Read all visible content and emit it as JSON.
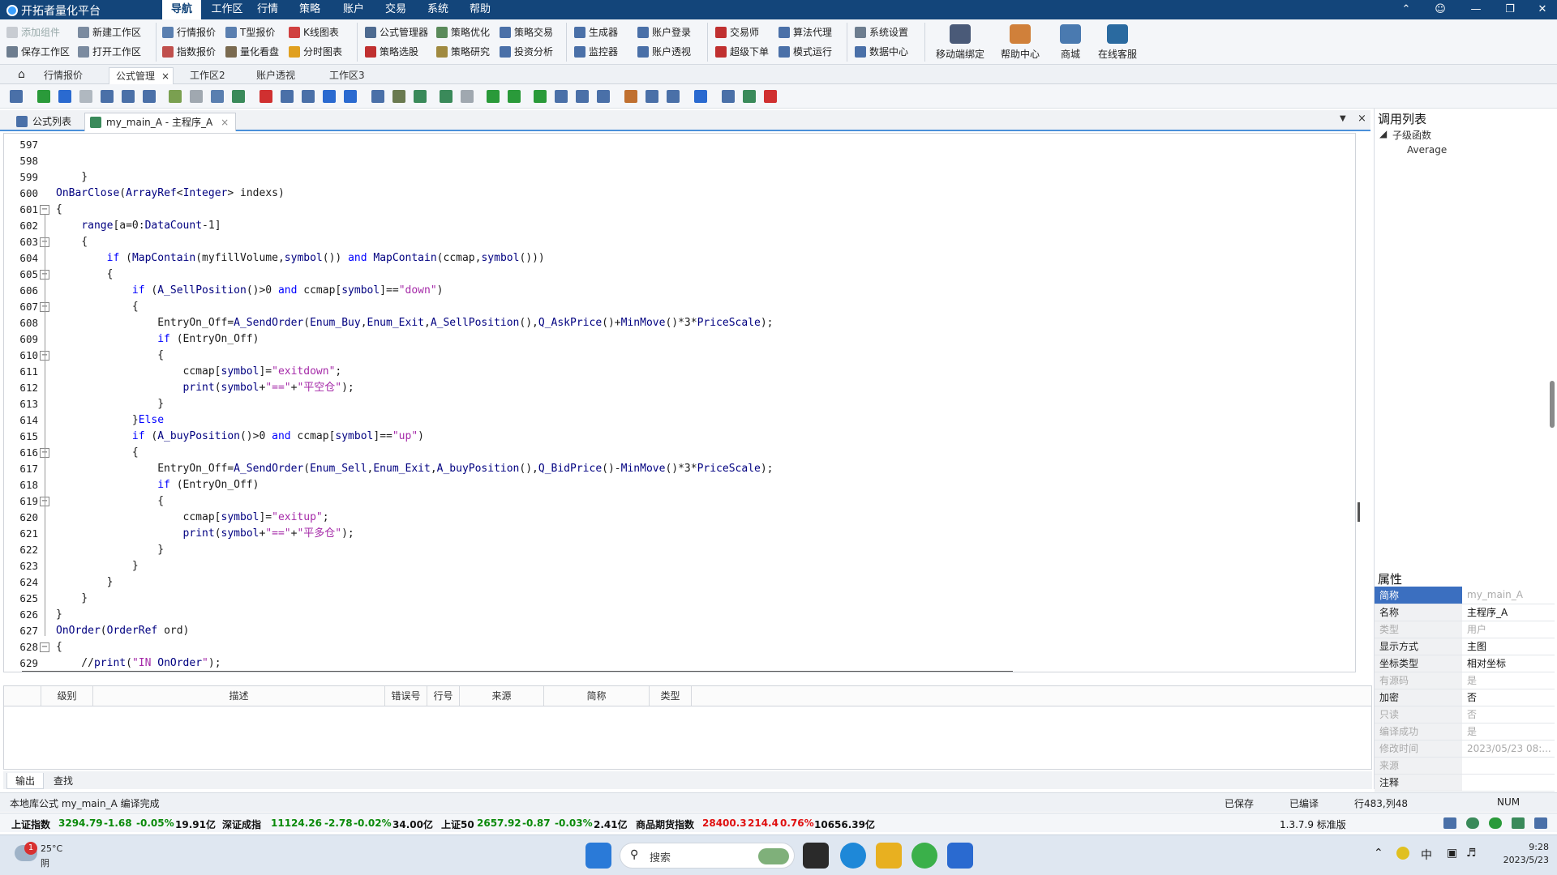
{
  "app": {
    "title": "开拓者量化平台"
  },
  "menus": [
    "导航",
    "工作区",
    "行情",
    "策略",
    "账户",
    "交易",
    "系统",
    "帮助"
  ],
  "ribbon": {
    "row1": [
      "添加组件",
      "新建工作区",
      "行情报价",
      "T型报价",
      "K线图表",
      "公式管理器",
      "策略优化",
      "策略交易",
      "生成器",
      "账户登录",
      "交易师",
      "算法代理",
      "系统设置"
    ],
    "row2": [
      "保存工作区",
      "打开工作区",
      "指数报价",
      "量化看盘",
      "分时图表",
      "策略选股",
      "策略研究",
      "投资分析",
      "监控器",
      "账户透视",
      "超级下单",
      "模式运行",
      "数据中心"
    ],
    "big": [
      "移动端绑定",
      "帮助中心",
      "商城",
      "在线客服"
    ]
  },
  "workspace_tabs": [
    "行情报价",
    "公式管理",
    "工作区2",
    "账户透视",
    "工作区3"
  ],
  "editor_tabs": [
    "公式列表",
    "my_main_A - 主程序_A"
  ],
  "code_lines": [
    {
      "n": "597",
      "t": ""
    },
    {
      "n": "598",
      "t": ""
    },
    {
      "n": "599",
      "t": "    }"
    },
    {
      "n": "600",
      "t": "OnBarClose(ArrayRef<Integer> indexs)"
    },
    {
      "n": "601",
      "t": "{"
    },
    {
      "n": "602",
      "t": "    range[a=0:DataCount-1]"
    },
    {
      "n": "603",
      "t": "    {"
    },
    {
      "n": "604",
      "t": "        if (MapContain(myfillVolume,symbol()) and MapContain(ccmap,symbol()))"
    },
    {
      "n": "605",
      "t": "        {"
    },
    {
      "n": "606",
      "t": "            if (A_SellPosition()>0 and ccmap[symbol]==\"down\")"
    },
    {
      "n": "607",
      "t": "            {"
    },
    {
      "n": "608",
      "t": "                EntryOn_Off=A_SendOrder(Enum_Buy,Enum_Exit,A_SellPosition(),Q_AskPrice()+MinMove()*3*PriceScale);"
    },
    {
      "n": "609",
      "t": "                if (EntryOn_Off)"
    },
    {
      "n": "610",
      "t": "                {"
    },
    {
      "n": "611",
      "t": "                    ccmap[symbol]=\"exitdown\";"
    },
    {
      "n": "612",
      "t": "                    print(symbol+\"==\"+\"平空仓\");"
    },
    {
      "n": "613",
      "t": "                }"
    },
    {
      "n": "614",
      "t": "            }Else"
    },
    {
      "n": "615",
      "t": "            if (A_buyPosition()>0 and ccmap[symbol]==\"up\")"
    },
    {
      "n": "616",
      "t": "            {"
    },
    {
      "n": "617",
      "t": "                EntryOn_Off=A_SendOrder(Enum_Sell,Enum_Exit,A_buyPosition(),Q_BidPrice()-MinMove()*3*PriceScale);"
    },
    {
      "n": "618",
      "t": "                if (EntryOn_Off)"
    },
    {
      "n": "619",
      "t": "                {"
    },
    {
      "n": "620",
      "t": "                    ccmap[symbol]=\"exitup\";"
    },
    {
      "n": "621",
      "t": "                    print(symbol+\"==\"+\"平多仓\");"
    },
    {
      "n": "622",
      "t": "                }"
    },
    {
      "n": "623",
      "t": "            }"
    },
    {
      "n": "624",
      "t": "        }"
    },
    {
      "n": "625",
      "t": "    }"
    },
    {
      "n": "626",
      "t": "}"
    },
    {
      "n": "627",
      "t": "OnOrder(OrderRef ord)"
    },
    {
      "n": "628",
      "t": "{"
    },
    {
      "n": "629",
      "t": "    //print(\"IN OnOrder\");"
    }
  ],
  "call_list": {
    "title": "调用列表",
    "group": "子级函数",
    "items": [
      "Average"
    ]
  },
  "properties": {
    "title": "属性",
    "rows": [
      {
        "k": "简称",
        "v": "my_main_A"
      },
      {
        "k": "名称",
        "v": "主程序_A"
      },
      {
        "k": "类型",
        "v": "用户"
      },
      {
        "k": "显示方式",
        "v": "主图"
      },
      {
        "k": "坐标类型",
        "v": "相对坐标"
      },
      {
        "k": "有源码",
        "v": "是"
      },
      {
        "k": "加密",
        "v": "否"
      },
      {
        "k": "只读",
        "v": "否"
      },
      {
        "k": "编译成功",
        "v": "是"
      },
      {
        "k": "修改时间",
        "v": "2023/05/23 08:..."
      },
      {
        "k": "来源",
        "v": ""
      },
      {
        "k": "注释",
        "v": ""
      }
    ]
  },
  "output_headers": [
    "级别",
    "描述",
    "错误号",
    "行号",
    "来源",
    "简称",
    "类型"
  ],
  "output_tabs": [
    "输出",
    "查找"
  ],
  "status": {
    "message": "本地库公式 my_main_A 编译完成",
    "saved": "已保存",
    "compiled": "已编译",
    "position": "行483,列48",
    "num": "NUM"
  },
  "ticker": [
    {
      "name": "上证指数",
      "price": "3294.79",
      "chg": "-1.68",
      "pct": "-0.05%",
      "vol": "19.91亿",
      "dir": "down"
    },
    {
      "name": "深证成指",
      "price": "11124.26",
      "chg": "-2.78",
      "pct": "-0.02%",
      "vol": "34.00亿",
      "dir": "down"
    },
    {
      "name": "上证50",
      "price": "2657.92",
      "chg": "-0.87",
      "pct": "-0.03%",
      "vol": "2.41亿",
      "dir": "down"
    },
    {
      "name": "商品期货指数",
      "price": "28400.3",
      "chg": "214.4",
      "pct": "0.76%",
      "vol": "10656.39亿",
      "dir": "up"
    }
  ],
  "version": "1.3.7.9 标准版",
  "taskbar": {
    "weather_temp": "25°C",
    "weather_desc": "阴",
    "badge": "1",
    "search": "搜索",
    "ime": "中",
    "time": "9:28",
    "date": "2023/5/23"
  }
}
